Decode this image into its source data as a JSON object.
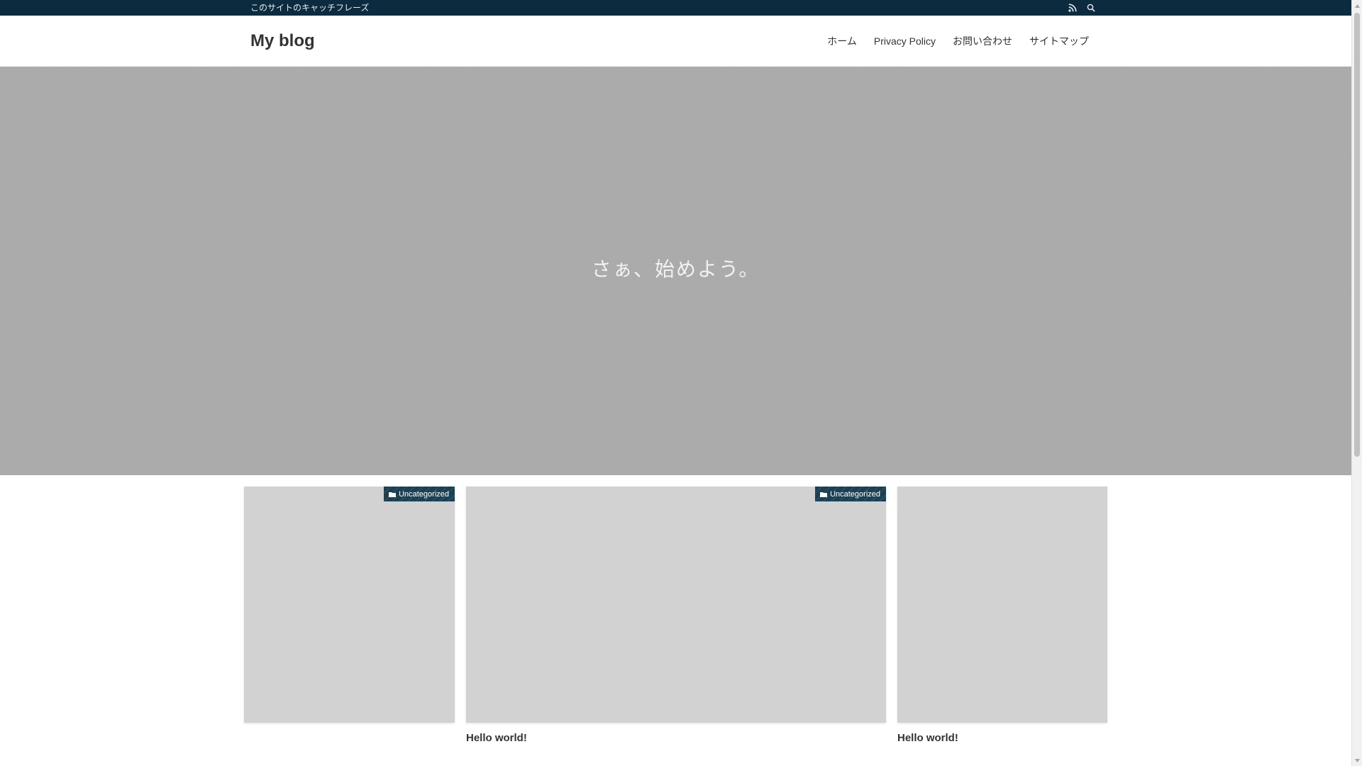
{
  "topbar": {
    "tagline": "このサイトのキャッチフレーズ",
    "icons": [
      "rss-icon",
      "search-icon"
    ]
  },
  "header": {
    "site_title": "My blog",
    "nav": [
      {
        "label": "ホーム"
      },
      {
        "label": "Privacy Policy"
      },
      {
        "label": "お問い合わせ"
      },
      {
        "label": "サイトマップ"
      }
    ]
  },
  "hero": {
    "text": "さぁ、始めよう。"
  },
  "posts": [
    {
      "category": "Uncategorized",
      "title": ""
    },
    {
      "category": "Uncategorized",
      "title": "Hello world!"
    },
    {
      "category": "",
      "title": "Hello world!"
    }
  ],
  "colors": {
    "topbar": "#0d2b3e",
    "hero": "#a9a9a9",
    "thumb_placeholder": "#d2d2d2",
    "category_badge": "#1d3f52"
  }
}
